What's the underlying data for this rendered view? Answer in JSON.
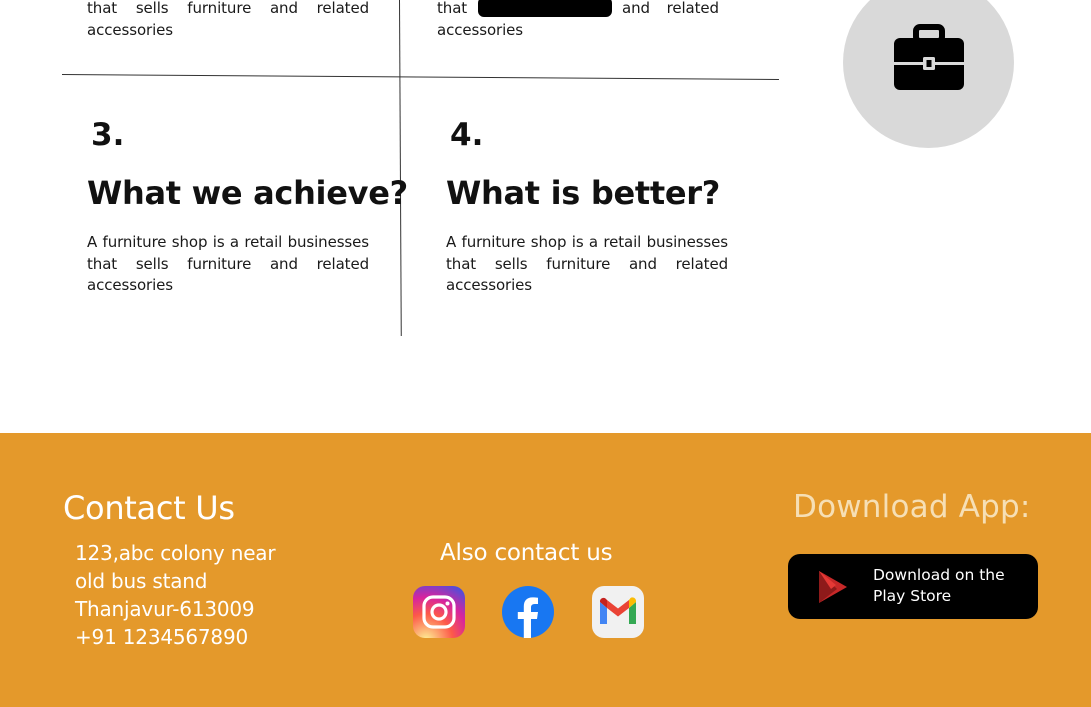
{
  "cards": [
    {
      "text": "that sells furniture and related accessories"
    },
    {
      "text_start": "that",
      "text_end": "and related",
      "text_line2": "accessories"
    },
    {
      "number": "3.",
      "title": "What we achieve?",
      "text": "A furniture shop is a retail businesses that sells furniture and related accessories"
    },
    {
      "number": "4.",
      "title": "What is better?",
      "text": "A furniture shop is a retail businesses that sells furniture and related accessories"
    }
  ],
  "footer": {
    "contact_title": "Contact Us",
    "address_line1": "123,abc colony near",
    "address_line2": "old bus stand",
    "address_line3": "Thanjavur-613009",
    "phone": "+91 1234567890",
    "also_contact": "Also contact us",
    "download_title": "Download App:",
    "store_line1": "Download on the",
    "store_line2": "Play Store"
  },
  "colors": {
    "footer_bg": "#e4992b",
    "circle_bg": "#d9d9d9"
  },
  "icons": [
    "briefcase-icon",
    "instagram-icon",
    "facebook-icon",
    "gmail-icon",
    "play-store-icon"
  ]
}
